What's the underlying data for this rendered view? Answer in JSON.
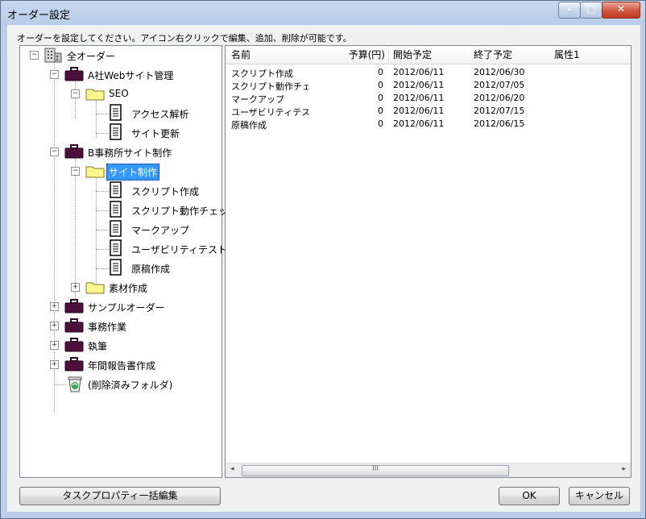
{
  "window": {
    "title": "オーダー設定"
  },
  "title_buttons": {
    "minimize": "–",
    "maximize": "□",
    "close": "✕"
  },
  "instruction": "オーダーを設定してください。アイコン右クリックで編集、追加、削除が可能です。",
  "tree": {
    "root": "全オーダー",
    "a_company": "A社Webサイト管理",
    "seo": "SEO",
    "access": "アクセス解析",
    "site_update": "サイト更新",
    "b_office": "B事務所サイト制作",
    "site_make": "サイト制作",
    "script_make": "スクリプト作成",
    "script_check": "スクリプト動作チェック",
    "markup": "マークアップ",
    "usability": "ユーザビリティテスト",
    "draft": "原稿作成",
    "material": "素材作成",
    "sample": "サンプルオーダー",
    "office_work": "事務作業",
    "writing": "執筆",
    "annual": "年間報告書作成",
    "deleted": "(削除済みフォルダ)"
  },
  "columns": {
    "name": "名前",
    "budget": "予算(円)",
    "start": "開始予定",
    "end": "終了予定",
    "attr": "属性1"
  },
  "rows": [
    {
      "name": "スクリプト作成",
      "budget": "0",
      "start": "2012/06/11",
      "end": "2012/06/30"
    },
    {
      "name": "スクリプト動作チェ…",
      "budget": "0",
      "start": "2012/06/11",
      "end": "2012/07/05"
    },
    {
      "name": "マークアップ",
      "budget": "0",
      "start": "2012/06/11",
      "end": "2012/06/20"
    },
    {
      "name": "ユーザビリティテスト",
      "budget": "0",
      "start": "2012/06/11",
      "end": "2012/07/15"
    },
    {
      "name": "原稿作成",
      "budget": "0",
      "start": "2012/06/11",
      "end": "2012/06/15"
    }
  ],
  "scrollbar": {
    "left": "◂",
    "grip": "III",
    "right": "▸"
  },
  "buttons": {
    "bulk_edit": "タスクプロパティ一括編集",
    "ok": "OK",
    "cancel": "キャンセル"
  },
  "colors": {
    "folder": "#fff68a",
    "briefcase": "#4a0f3a",
    "selection": "#3399ff"
  }
}
